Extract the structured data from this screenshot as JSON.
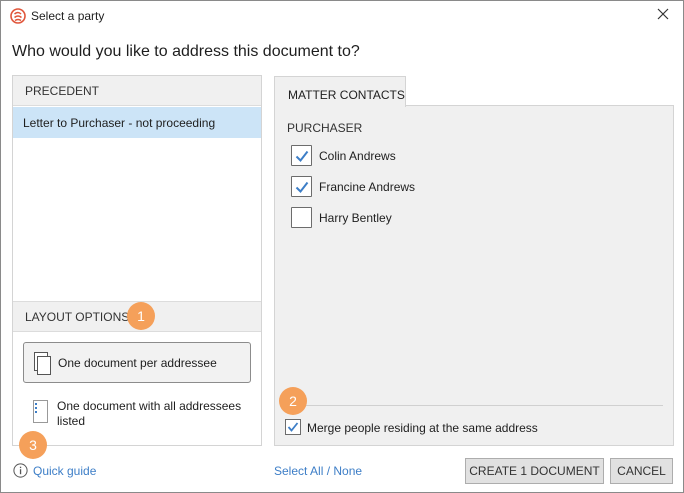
{
  "window": {
    "title": "Select a party",
    "app_icon": "app-logo-icon",
    "close_icon": "close-icon"
  },
  "question": "Who would you like to address this document to?",
  "precedent": {
    "header": "PRECEDENT",
    "selected_item": "Letter to Purchaser - not proceeding"
  },
  "layout_options": {
    "header": "LAYOUT OPTIONS",
    "option1": "One document per addressee",
    "option2_line1": "One document with all addressees",
    "option2_line2": "listed"
  },
  "matter_contacts": {
    "tab_label": "MATTER CONTACTS",
    "group_label": "PURCHASER",
    "contacts": [
      {
        "name": "Colin Andrews",
        "checked": true
      },
      {
        "name": "Francine Andrews",
        "checked": true
      },
      {
        "name": "Harry Bentley",
        "checked": false
      }
    ],
    "merge_label": "Merge people residing at the same address",
    "merge_checked": true
  },
  "badges": [
    "1",
    "2",
    "3"
  ],
  "footer": {
    "quick_guide": "Quick guide",
    "select_all": "Select All / None",
    "create_button": "CREATE 1 DOCUMENT",
    "cancel_button": "CANCEL"
  },
  "colors": {
    "accent": "#3d7ec7",
    "badge": "#f5a05a",
    "selection": "#cce4f7",
    "brand": "#e0553a"
  }
}
